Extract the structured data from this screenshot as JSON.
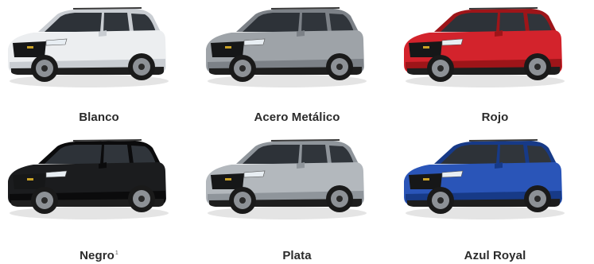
{
  "colors": [
    {
      "name": "Blanco",
      "body": "#eceef0",
      "shade": "#c9cdd2",
      "note": ""
    },
    {
      "name": "Acero Metálico",
      "body": "#9ea3a8",
      "shade": "#7c8187",
      "note": ""
    },
    {
      "name": "Rojo",
      "body": "#d3232c",
      "shade": "#9e1519",
      "note": ""
    },
    {
      "name": "Negro",
      "body": "#1b1c1e",
      "shade": "#0b0b0c",
      "note": "1"
    },
    {
      "name": "Plata",
      "body": "#b3b8bd",
      "shade": "#8f959b",
      "note": ""
    },
    {
      "name": "Azul Royal",
      "body": "#2a55b8",
      "shade": "#173a87",
      "note": ""
    }
  ]
}
